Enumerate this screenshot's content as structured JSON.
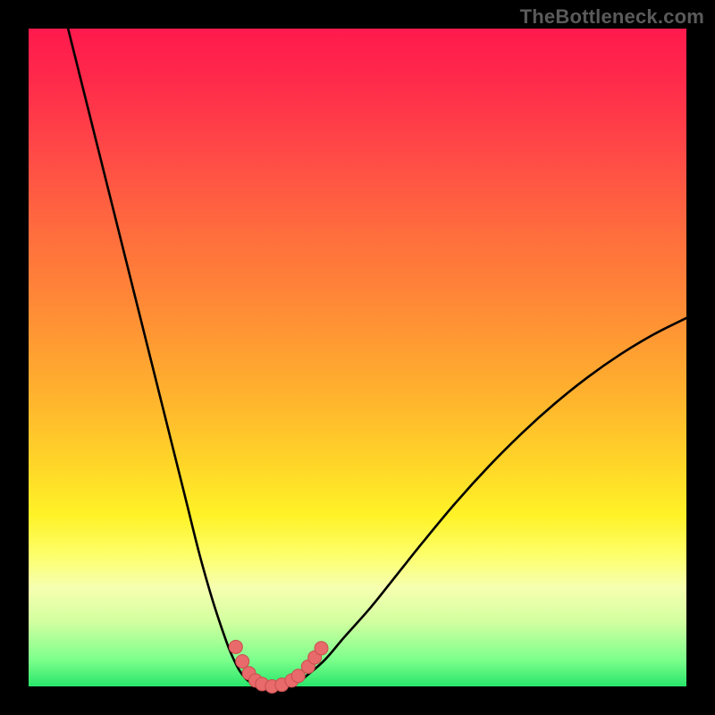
{
  "watermark": "TheBottleneck.com",
  "colors": {
    "frame": "#000000",
    "curve": "#000000",
    "marker_fill": "#e86a6a",
    "marker_stroke": "#c94f4f"
  },
  "chart_data": {
    "type": "line",
    "title": "",
    "xlabel": "",
    "ylabel": "",
    "xlim": [
      0,
      100
    ],
    "ylim": [
      0,
      100
    ],
    "grid": false,
    "legend": false,
    "series": [
      {
        "name": "left-branch",
        "x": [
          6,
          8,
          10,
          12,
          14,
          16,
          18,
          20,
          22,
          24,
          26,
          28,
          30,
          31,
          32,
          33,
          34
        ],
        "y": [
          100,
          92,
          84,
          76,
          68,
          60,
          52,
          44,
          36,
          28,
          20,
          13,
          7,
          4.5,
          2.5,
          1.2,
          0.4
        ]
      },
      {
        "name": "valley-floor",
        "x": [
          34,
          35,
          36,
          37,
          38,
          39,
          40,
          41,
          42
        ],
        "y": [
          0.4,
          0.15,
          0.05,
          0.0,
          0.05,
          0.15,
          0.4,
          0.8,
          1.4
        ]
      },
      {
        "name": "right-branch",
        "x": [
          42,
          45,
          48,
          52,
          56,
          60,
          65,
          70,
          75,
          80,
          85,
          90,
          95,
          100
        ],
        "y": [
          1.4,
          4,
          7.5,
          12,
          17,
          22,
          28,
          33.5,
          38.5,
          43,
          47,
          50.5,
          53.5,
          56
        ]
      }
    ],
    "markers": [
      {
        "x": 31.5,
        "y": 6.0
      },
      {
        "x": 32.5,
        "y": 3.8
      },
      {
        "x": 33.5,
        "y": 2.0
      },
      {
        "x": 34.5,
        "y": 0.9
      },
      {
        "x": 35.5,
        "y": 0.35
      },
      {
        "x": 37.0,
        "y": 0.0
      },
      {
        "x": 38.5,
        "y": 0.25
      },
      {
        "x": 40.0,
        "y": 0.9
      },
      {
        "x": 41.0,
        "y": 1.6
      },
      {
        "x": 42.5,
        "y": 3.0
      },
      {
        "x": 43.5,
        "y": 4.4
      },
      {
        "x": 44.5,
        "y": 5.8
      }
    ],
    "note": "Axes are unlabeled in the source image; x/y inferred as 0–100 relative scales. Left branch is nearly linear descending; right branch is a concave-down rise toward ~56 at x=100."
  }
}
